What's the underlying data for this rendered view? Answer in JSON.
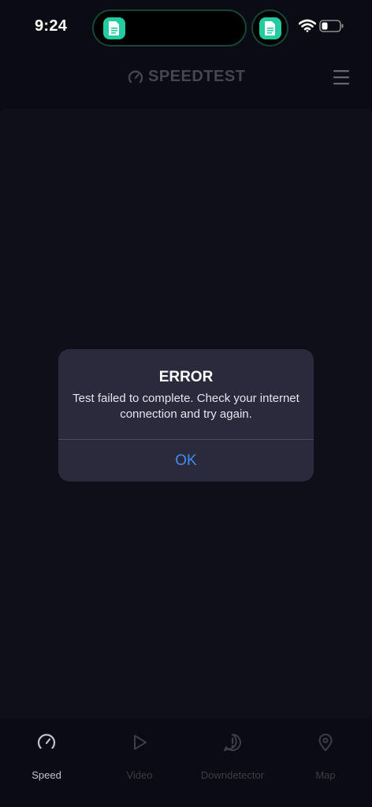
{
  "status_bar": {
    "time": "9:24",
    "icons": [
      "document-app-icon",
      "wifi-icon",
      "battery-icon"
    ]
  },
  "header": {
    "brand": "SPEEDTEST",
    "icons": [
      "speedometer-logo-icon",
      "hamburger-menu-icon"
    ]
  },
  "alert": {
    "title": "ERROR",
    "message": "Test failed to complete. Check your internet connection and try again.",
    "ok_label": "OK"
  },
  "tabs": [
    {
      "label": "Speed",
      "icon": "speedometer-icon",
      "active": true
    },
    {
      "label": "Video",
      "icon": "play-icon",
      "active": false
    },
    {
      "label": "Downdetector",
      "icon": "alert-icon",
      "active": false
    },
    {
      "label": "Map",
      "icon": "map-pin-icon",
      "active": false
    }
  ],
  "colors": {
    "background": "#0b0b13",
    "panel": "#0f0f1a",
    "alert_bg": "#2b2a3c",
    "accent_blue": "#3e8cf0",
    "island_app_green": "#22cca0"
  }
}
